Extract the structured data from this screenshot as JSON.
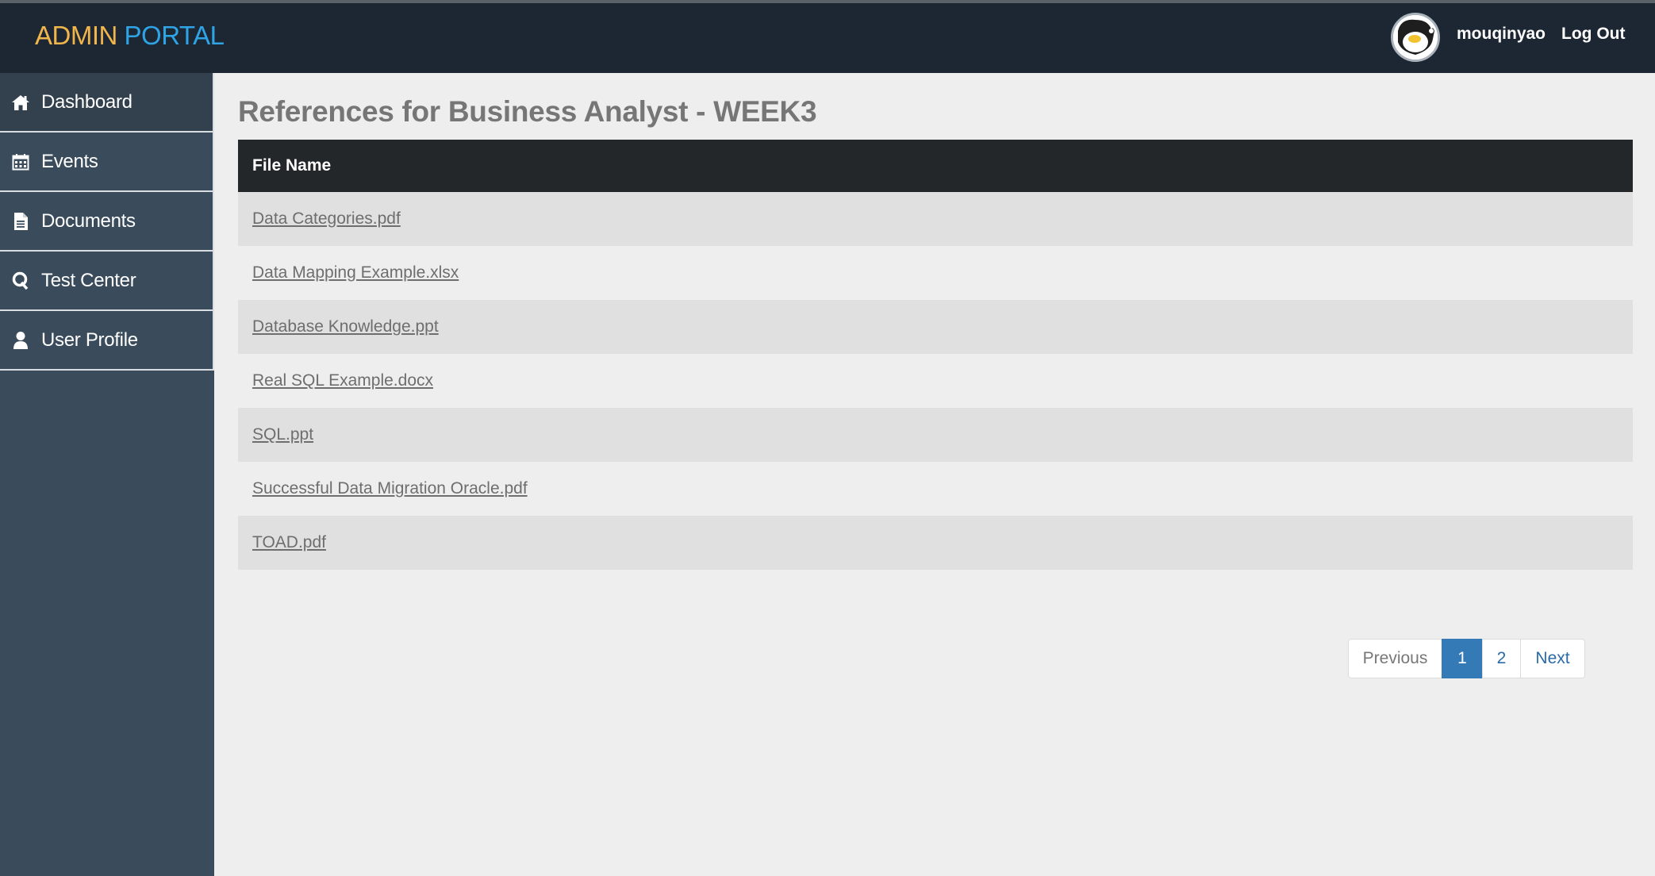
{
  "header": {
    "brand_part1": "ADMIN",
    "brand_part2": "PORTAL",
    "username": "mouqinyao",
    "logout_label": "Log Out",
    "colors": {
      "brand1": "#f0b54b",
      "brand2": "#2ea4e6",
      "bar": "#1c2733"
    }
  },
  "sidebar": {
    "items": [
      {
        "label": "Dashboard",
        "icon": "home-icon"
      },
      {
        "label": "Events",
        "icon": "calendar-icon"
      },
      {
        "label": "Documents",
        "icon": "document-icon"
      },
      {
        "label": "Test Center",
        "icon": "q-icon"
      },
      {
        "label": "User Profile",
        "icon": "user-icon"
      }
    ]
  },
  "main": {
    "title": "References for Business Analyst - WEEK3",
    "table": {
      "header": "File Name",
      "rows": [
        "Data Categories.pdf",
        "Data Mapping Example.xlsx",
        "Database Knowledge.ppt",
        "Real SQL Example.docx",
        "SQL.ppt",
        "Successful Data Migration Oracle.pdf",
        "TOAD.pdf"
      ]
    },
    "pagination": {
      "previous": "Previous",
      "pages": [
        "1",
        "2"
      ],
      "current": "1",
      "next": "Next"
    }
  }
}
